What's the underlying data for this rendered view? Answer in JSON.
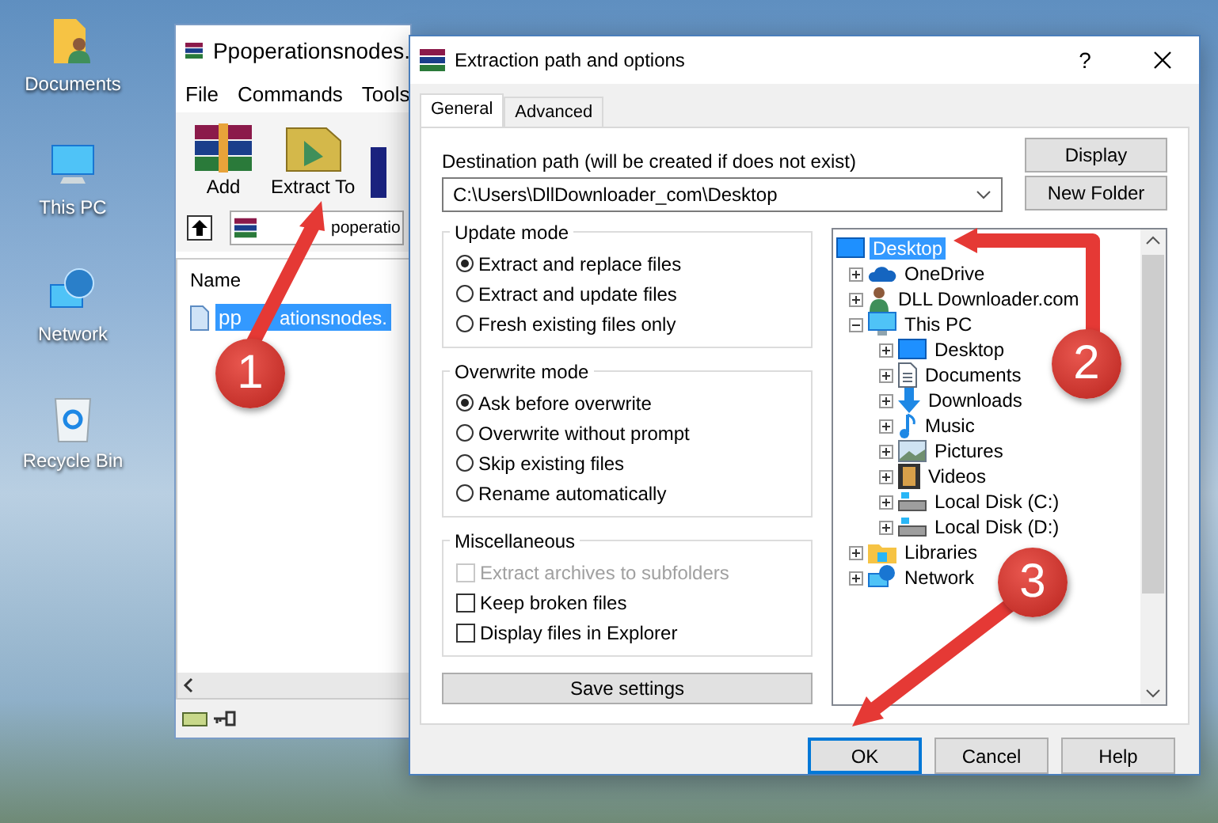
{
  "desktop_icons": [
    {
      "label": "Documents",
      "kind": "documents"
    },
    {
      "label": "This PC",
      "kind": "pc"
    },
    {
      "label": "Network",
      "kind": "network"
    },
    {
      "label": "Recycle Bin",
      "kind": "recycle"
    }
  ],
  "background_window": {
    "title": "Ppoperationsnodes.",
    "menu": [
      "File",
      "Commands",
      "Tools"
    ],
    "toolbar": [
      {
        "label": "Add",
        "kind": "add"
      },
      {
        "label": "Extract To",
        "kind": "extract"
      }
    ],
    "path": "poperatio",
    "column": "Name",
    "file": {
      "visible_text": [
        "pp",
        "ationsnodes."
      ],
      "selected": true
    }
  },
  "dialog": {
    "title": "Extraction path and options",
    "help": "?",
    "tabs": [
      {
        "label": "General",
        "selected": true
      },
      {
        "label": "Advanced",
        "selected": false
      }
    ],
    "destination_label": "Destination path (will be created if does not exist)",
    "destination_path": "C:\\Users\\DllDownloader_com\\Desktop",
    "side_buttons": [
      "Display",
      "New Folder"
    ],
    "groups": [
      {
        "title": "Update mode",
        "options": [
          {
            "kind": "radio",
            "label": "Extract and replace files",
            "checked": true,
            "disabled": false
          },
          {
            "kind": "radio",
            "label": "Extract and update files",
            "checked": false,
            "disabled": false
          },
          {
            "kind": "radio",
            "label": "Fresh existing files only",
            "checked": false,
            "disabled": false
          }
        ]
      },
      {
        "title": "Overwrite mode",
        "options": [
          {
            "kind": "radio",
            "label": "Ask before overwrite",
            "checked": true,
            "disabled": false
          },
          {
            "kind": "radio",
            "label": "Overwrite without prompt",
            "checked": false,
            "disabled": false
          },
          {
            "kind": "radio",
            "label": "Skip existing files",
            "checked": false,
            "disabled": false
          },
          {
            "kind": "radio",
            "label": "Rename automatically",
            "checked": false,
            "disabled": false
          }
        ]
      },
      {
        "title": "Miscellaneous",
        "options": [
          {
            "kind": "checkbox",
            "label": "Extract archives to subfolders",
            "checked": false,
            "disabled": true
          },
          {
            "kind": "checkbox",
            "label": "Keep broken files",
            "checked": false,
            "disabled": false
          },
          {
            "kind": "checkbox",
            "label": "Display files in Explorer",
            "checked": false,
            "disabled": false
          }
        ]
      }
    ],
    "save_button": "Save settings",
    "tree": [
      {
        "label": "Desktop",
        "kind": "desktop",
        "selected": true,
        "children": [
          {
            "label": "OneDrive",
            "kind": "cloud",
            "selected": false,
            "expanded": false
          },
          {
            "label": "DLL Downloader.com",
            "kind": "user",
            "selected": false,
            "expanded": false
          },
          {
            "label": "This PC",
            "kind": "pc",
            "selected": false,
            "expanded": true,
            "children": [
              {
                "label": "Desktop",
                "kind": "desktop",
                "selected": false,
                "expanded": false
              },
              {
                "label": "Documents",
                "kind": "document",
                "selected": false,
                "expanded": false
              },
              {
                "label": "Downloads",
                "kind": "download",
                "selected": false,
                "expanded": false
              },
              {
                "label": "Music",
                "kind": "music",
                "selected": false,
                "expanded": false
              },
              {
                "label": "Pictures",
                "kind": "pictures",
                "selected": false,
                "expanded": false
              },
              {
                "label": "Videos",
                "kind": "videos",
                "selected": false,
                "expanded": false
              },
              {
                "label": "Local Disk (C:)",
                "kind": "disk",
                "selected": false,
                "expanded": false
              },
              {
                "label": "Local Disk (D:)",
                "kind": "disk",
                "selected": false,
                "expanded": false
              }
            ]
          },
          {
            "label": "Libraries",
            "kind": "library",
            "selected": false,
            "expanded": false
          },
          {
            "label": "Network",
            "kind": "network",
            "selected": false,
            "expanded": false
          }
        ]
      }
    ],
    "buttons": [
      {
        "label": "OK",
        "default": true
      },
      {
        "label": "Cancel",
        "default": false
      },
      {
        "label": "Help",
        "default": false
      }
    ]
  },
  "annotations": [
    {
      "number": "1"
    },
    {
      "number": "2"
    },
    {
      "number": "3"
    }
  ]
}
